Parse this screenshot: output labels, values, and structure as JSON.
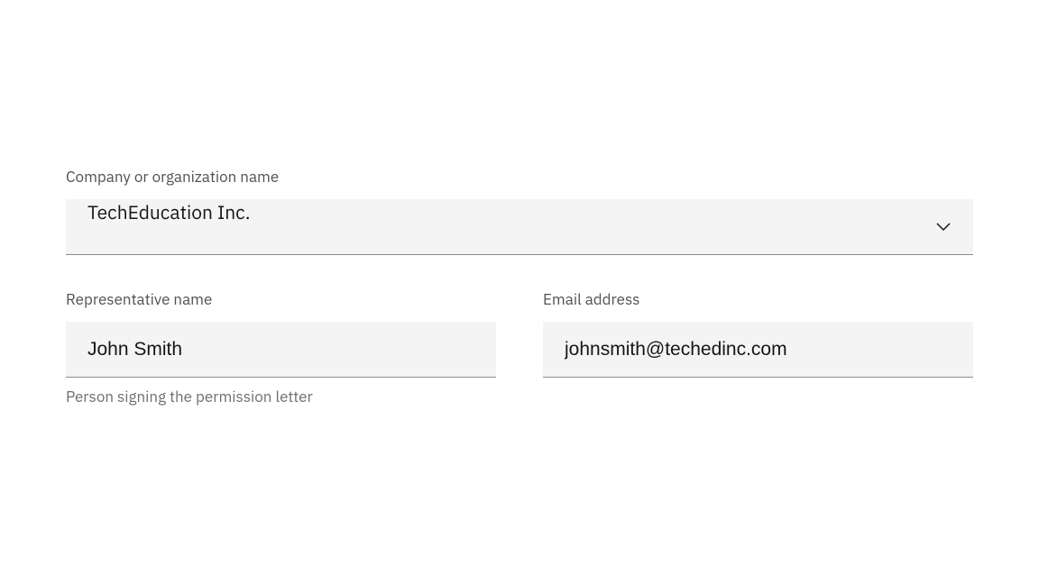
{
  "company": {
    "label": "Company or organization name",
    "value": "TechEducation Inc."
  },
  "representative": {
    "label": "Representative name",
    "value": "John Smith",
    "helper": "Person signing the permission letter"
  },
  "email": {
    "label": "Email address",
    "value": "johnsmith@techedinc.com"
  }
}
